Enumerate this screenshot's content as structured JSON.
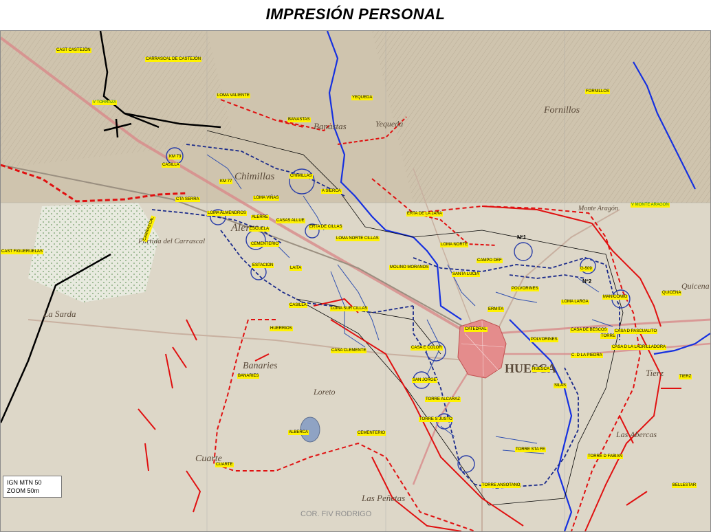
{
  "title": "IMPRESIÓN PERSONAL",
  "legend": {
    "line1": "IGN MTN 50",
    "line2": "ZOOM 50m"
  },
  "credit": "COR. FIV RODRIGO",
  "labels": [
    {
      "id": "cast-castejon",
      "text": "CAST CASTEJÓN"
    },
    {
      "id": "carrascal-castejon",
      "text": "CARRASCAL DE CASTEJÓN"
    },
    {
      "id": "v-torraza",
      "text": "V TORRAZA"
    },
    {
      "id": "loma-valiente",
      "text": "LOMA VALIENTE"
    },
    {
      "id": "yequeda",
      "text": "YEQUEDA"
    },
    {
      "id": "banastas",
      "text": "BANASTAS"
    },
    {
      "id": "fornillos",
      "text": "FORNILLOS"
    },
    {
      "id": "km-73",
      "text": "KM 73"
    },
    {
      "id": "casilla-1",
      "text": "CASILLA"
    },
    {
      "id": "km-77",
      "text": "KM 77"
    },
    {
      "id": "chimillas",
      "text": "CHIMILLAS"
    },
    {
      "id": "a-sierca",
      "text": "A SIERCA"
    },
    {
      "id": "cta-serra",
      "text": "CTA SERRA"
    },
    {
      "id": "loma-vinas",
      "text": "LOMA VIÑAS"
    },
    {
      "id": "loma-almendros",
      "text": "LOMA ALMENDROS"
    },
    {
      "id": "alerre",
      "text": "ALERRE"
    },
    {
      "id": "escuela",
      "text": "ESCUELA"
    },
    {
      "id": "casas-allue",
      "text": "CASAS ALLUE"
    },
    {
      "id": "erta-de-la-jara",
      "text": "ERTA DE LA JARA"
    },
    {
      "id": "v-monte-aragon",
      "text": "V MONTE ARAGON"
    },
    {
      "id": "erta-de-cillas",
      "text": "ERTA DE CILLAS"
    },
    {
      "id": "loma-norte-cillas",
      "text": "LOMA NORTE CILLAS"
    },
    {
      "id": "cementerio-1",
      "text": "CEMENTERIO"
    },
    {
      "id": "cast-figueruelas",
      "text": "CAST FIGUERUELAS"
    },
    {
      "id": "loma-norte",
      "text": "LOMA NORTE"
    },
    {
      "id": "campo-def",
      "text": "CAMPO DEF"
    },
    {
      "id": "estacion",
      "text": "ESTACION"
    },
    {
      "id": "laita",
      "text": "LAITA"
    },
    {
      "id": "molino-moranos",
      "text": "MOLINO MORANOS"
    },
    {
      "id": "santa-lucia",
      "text": "SANTA LUCIA"
    },
    {
      "id": "g-509",
      "text": "G-509"
    },
    {
      "id": "polvorines-1",
      "text": "POLVORINES"
    },
    {
      "id": "loma-larga",
      "text": "LOMA LARGA"
    },
    {
      "id": "manicomio",
      "text": "MANICOMIO"
    },
    {
      "id": "quicena",
      "text": "QUICENA"
    },
    {
      "id": "casilla-2",
      "text": "CASILLA"
    },
    {
      "id": "loma-sur-cillas",
      "text": "LOMA SUR CILLAS"
    },
    {
      "id": "ermita",
      "text": "ERMITA"
    },
    {
      "id": "huerrios",
      "text": "HUERRIOS"
    },
    {
      "id": "catedral",
      "text": "CATEDRAL"
    },
    {
      "id": "casa-del-bescos",
      "text": "CASA DE BESCOS"
    },
    {
      "id": "torre",
      "text": "TORRE"
    },
    {
      "id": "casa-pascualito",
      "text": "CASA D PASCUALITO"
    },
    {
      "id": "polvorines-2",
      "text": "POLVORINES"
    },
    {
      "id": "casa-clemente",
      "text": "CASA CLEMENTE"
    },
    {
      "id": "casa-e-color",
      "text": "CASA E COLOR"
    },
    {
      "id": "c-de-la-piedra",
      "text": "C. D LA PIEDRA"
    },
    {
      "id": "casa-ladrilladora",
      "text": "CASA D LA LADRILLADORA"
    },
    {
      "id": "banaries",
      "text": "BANARIES"
    },
    {
      "id": "huesca",
      "text": "HUESCA"
    },
    {
      "id": "silas",
      "text": "SILAS"
    },
    {
      "id": "san-jorge",
      "text": "SAN JORGE"
    },
    {
      "id": "tierz",
      "text": "TIERZ"
    },
    {
      "id": "torre-alcaraz",
      "text": "TORRE ALCARAZ"
    },
    {
      "id": "torre-s-justo",
      "text": "TORRE S JUSTO"
    },
    {
      "id": "alberca",
      "text": "ALBERCA"
    },
    {
      "id": "cementerio-2",
      "text": "CEMENTERIO"
    },
    {
      "id": "torre-sta-fe",
      "text": "TORRE STA FE"
    },
    {
      "id": "torre-d-fabian",
      "text": "TORRE D FABIAN"
    },
    {
      "id": "cuarte",
      "text": "CUARTE"
    },
    {
      "id": "torre-ansotano",
      "text": "TORRE ANSOTANO"
    },
    {
      "id": "bellestar",
      "text": "BELLESTAR"
    },
    {
      "id": "carrascal",
      "text": "CARRASCAL"
    }
  ],
  "black_labels": [
    {
      "id": "n1",
      "text": "Nº1"
    },
    {
      "id": "n2",
      "text": "Nº2"
    }
  ],
  "map_text": [
    {
      "id": "chimillas-base",
      "text": "Chimillas"
    },
    {
      "id": "alerre-base",
      "text": "Alerre"
    },
    {
      "id": "huesca-base",
      "text": "HUESCA"
    },
    {
      "id": "banaries-base",
      "text": "Banaries"
    },
    {
      "id": "cuarte-base",
      "text": "Cuarte"
    },
    {
      "id": "sarda-base",
      "text": "La Sarda"
    },
    {
      "id": "carrascal-base",
      "text": "Partida del Carrascal"
    },
    {
      "id": "fornillos-base",
      "text": "Fornillos"
    },
    {
      "id": "banastas-base",
      "text": "Banastas"
    },
    {
      "id": "quicena-base",
      "text": "Quicena"
    },
    {
      "id": "tierz-base",
      "text": "Tierz"
    },
    {
      "id": "abercas-base",
      "text": "Las Abercas"
    },
    {
      "id": "penetas-base",
      "text": "Las Peñetas"
    },
    {
      "id": "loreto-base",
      "text": "Loreto"
    },
    {
      "id": "yequeda-base",
      "text": "Yequeda"
    },
    {
      "id": "mont-aragon-base",
      "text": "Monte Aragón"
    }
  ],
  "colors": {
    "river": "#1530e0",
    "red_route": "#e01010",
    "blue_route": "#1a2a8a",
    "black_line": "#000000",
    "label_bg": "#fff200",
    "road": "#d88a8a"
  },
  "icons": [
    "cross-marker",
    "circle-marker"
  ]
}
